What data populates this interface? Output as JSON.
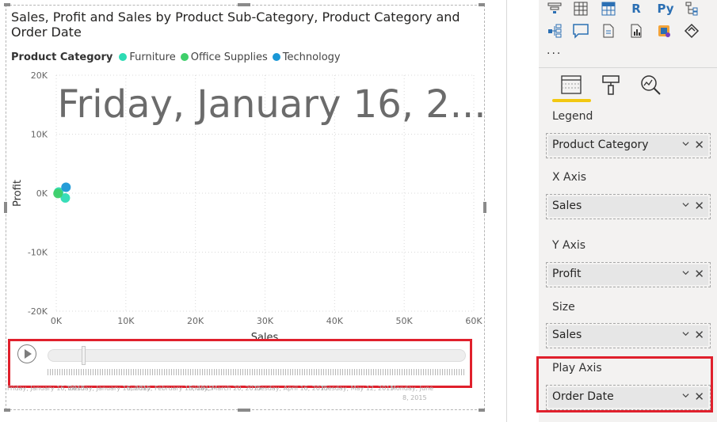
{
  "visual": {
    "title": "Sales, Profit and Sales by Product Sub-Category, Product Category and Order Date",
    "legend_title": "Product Category",
    "legend": [
      {
        "label": "Furniture",
        "color": "#2ddbb4"
      },
      {
        "label": "Office Supplies",
        "color": "#3fcf6a"
      },
      {
        "label": "Technology",
        "color": "#1a97d6"
      }
    ],
    "watermark": "Friday, January 16, 2..."
  },
  "chart_data": {
    "type": "scatter",
    "xlabel": "Sales",
    "ylabel": "Profit",
    "xlim": [
      0,
      60000
    ],
    "ylim": [
      -20000,
      20000
    ],
    "x_ticks": [
      "0K",
      "10K",
      "20K",
      "30K",
      "40K",
      "50K",
      "60K"
    ],
    "y_ticks": [
      "20K",
      "10K",
      "0K",
      "-10K",
      "-20K"
    ],
    "grid": true,
    "legend_position": "top-left",
    "series": [
      {
        "name": "Furniture",
        "color": "#2ddbb4",
        "points": [
          {
            "x": 350,
            "y": 200
          },
          {
            "x": 1300,
            "y": -800
          }
        ]
      },
      {
        "name": "Office Supplies",
        "color": "#3fcf6a",
        "points": [
          {
            "x": 250,
            "y": -50
          }
        ]
      },
      {
        "name": "Technology",
        "color": "#1a97d6",
        "points": [
          {
            "x": 1400,
            "y": 1000
          }
        ]
      }
    ]
  },
  "play_axis": {
    "labels": [
      "Friday, January 16, 2015",
      "Tuesday, January 16, 2015",
      "Sunday, February 15, 2015",
      "Friday, March 20, 2015",
      "Tuesday, April 16, 2015",
      "Tuesday, May 12, 2015"
    ],
    "last_label_line1": "Monday, June",
    "last_label_line2": "8, 2015"
  },
  "viz_pane": {
    "icons": [
      {
        "name": "funnel-icon"
      },
      {
        "name": "table-icon"
      },
      {
        "name": "matrix-icon"
      },
      {
        "name": "r-visual-icon",
        "glyph": "R"
      },
      {
        "name": "python-visual-icon",
        "glyph": "Py"
      },
      {
        "name": "smart-narrative-icon"
      },
      {
        "name": "decomposition-tree-icon"
      },
      {
        "name": "qa-icon"
      },
      {
        "name": "paginated-report-icon"
      },
      {
        "name": "key-influencers-icon"
      },
      {
        "name": "power-apps-icon"
      },
      {
        "name": "power-automate-icon"
      }
    ],
    "more": "...",
    "tabs": [
      "fields-tab",
      "format-tab",
      "analytics-tab"
    ],
    "wells": [
      {
        "label": "Legend",
        "value": "Product Category"
      },
      {
        "label": "X Axis",
        "value": "Sales"
      },
      {
        "label": "Y Axis",
        "value": "Profit"
      },
      {
        "label": "Size",
        "value": "Sales"
      },
      {
        "label": "Play Axis",
        "value": "Order Date"
      }
    ]
  }
}
